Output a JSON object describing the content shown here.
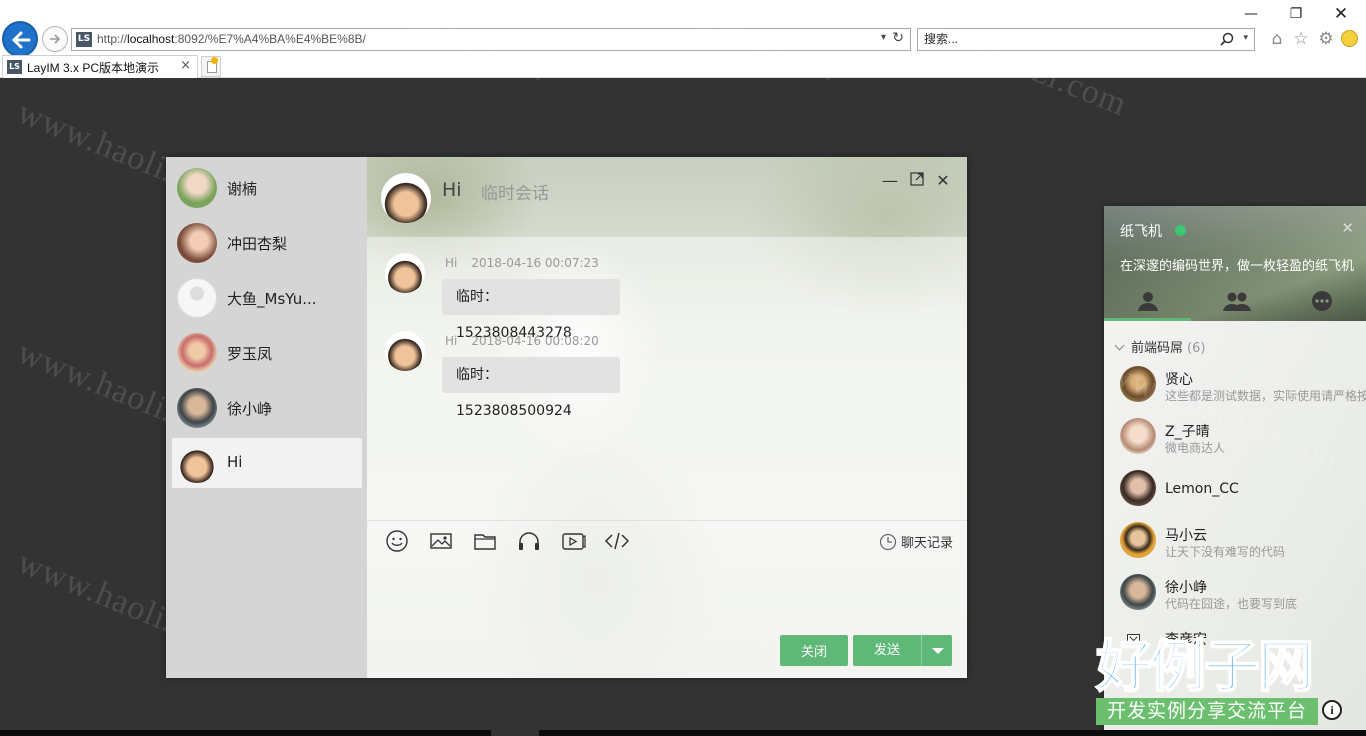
{
  "browser": {
    "url_prefix": "http://",
    "url_host": "localhost",
    "url_rest": ":8092/%E7%A4%BA%E4%BE%8B/",
    "search_placeholder": "搜索...",
    "tab_title": "LayIM 3.x PC版本地演示",
    "site_badge": "LS"
  },
  "chat": {
    "title": "Hi",
    "subtitle": "临时会话",
    "sidebar": [
      {
        "name": "谢楠",
        "avatar": "#7aa35b"
      },
      {
        "name": "冲田杏梨",
        "avatar": "#c98b6b"
      },
      {
        "name": "大鱼_MsYu...",
        "avatar": "#eeeeee"
      },
      {
        "name": "罗玉凤",
        "avatar": "#d9a07a"
      },
      {
        "name": "徐小峥",
        "avatar": "#6d7579"
      },
      {
        "name": "Hi",
        "avatar": "#3a2a22"
      }
    ],
    "messages": [
      {
        "user": "Hi",
        "time": "2018-04-16 00:07:23",
        "text": "临时：1523808443278"
      },
      {
        "user": "Hi",
        "time": "2018-04-16 00:08:20",
        "text": "临时：1523808500924"
      }
    ],
    "tools": [
      "emoji-icon",
      "image-icon",
      "folder-icon",
      "headphones-icon",
      "video-icon",
      "code-icon"
    ],
    "history_label": "聊天记录",
    "close_label": "关闭",
    "send_label": "发送"
  },
  "main_panel": {
    "username": "纸飞机",
    "sign": "在深邃的编码世界，做一枚轻盈的纸飞机",
    "tabs": [
      "friend-tab-icon",
      "group-tab-icon",
      "history-tab-icon"
    ],
    "group": {
      "name": "前端码屌",
      "count": "(6)"
    },
    "friends": [
      {
        "name": "贤心",
        "sign": "这些都是测试数据，实际使用请严格按照该格式返回",
        "avatar": "#8a6a3a"
      },
      {
        "name": "Z_子晴",
        "sign": "微电商达人",
        "avatar": "#d8b7a2"
      },
      {
        "name": "Lemon_CC",
        "sign": "",
        "avatar": "#4a3a33"
      },
      {
        "name": "马小云",
        "sign": "让天下没有难写的代码",
        "avatar": "#e2a33a"
      },
      {
        "name": "徐小峥",
        "sign": "代码在囧途，也要写到底",
        "avatar": "#6d7579"
      },
      {
        "name": "李彦宏",
        "sign": "",
        "avatar": "#cccccc"
      }
    ]
  },
  "watermark": "www.haolizi.com",
  "logo": {
    "main": "好例子网",
    "sub": "开发实例分享交流平台"
  },
  "colors": {
    "accent": "#5fb878",
    "online": "#3cc870",
    "backdrop": "#333333"
  }
}
